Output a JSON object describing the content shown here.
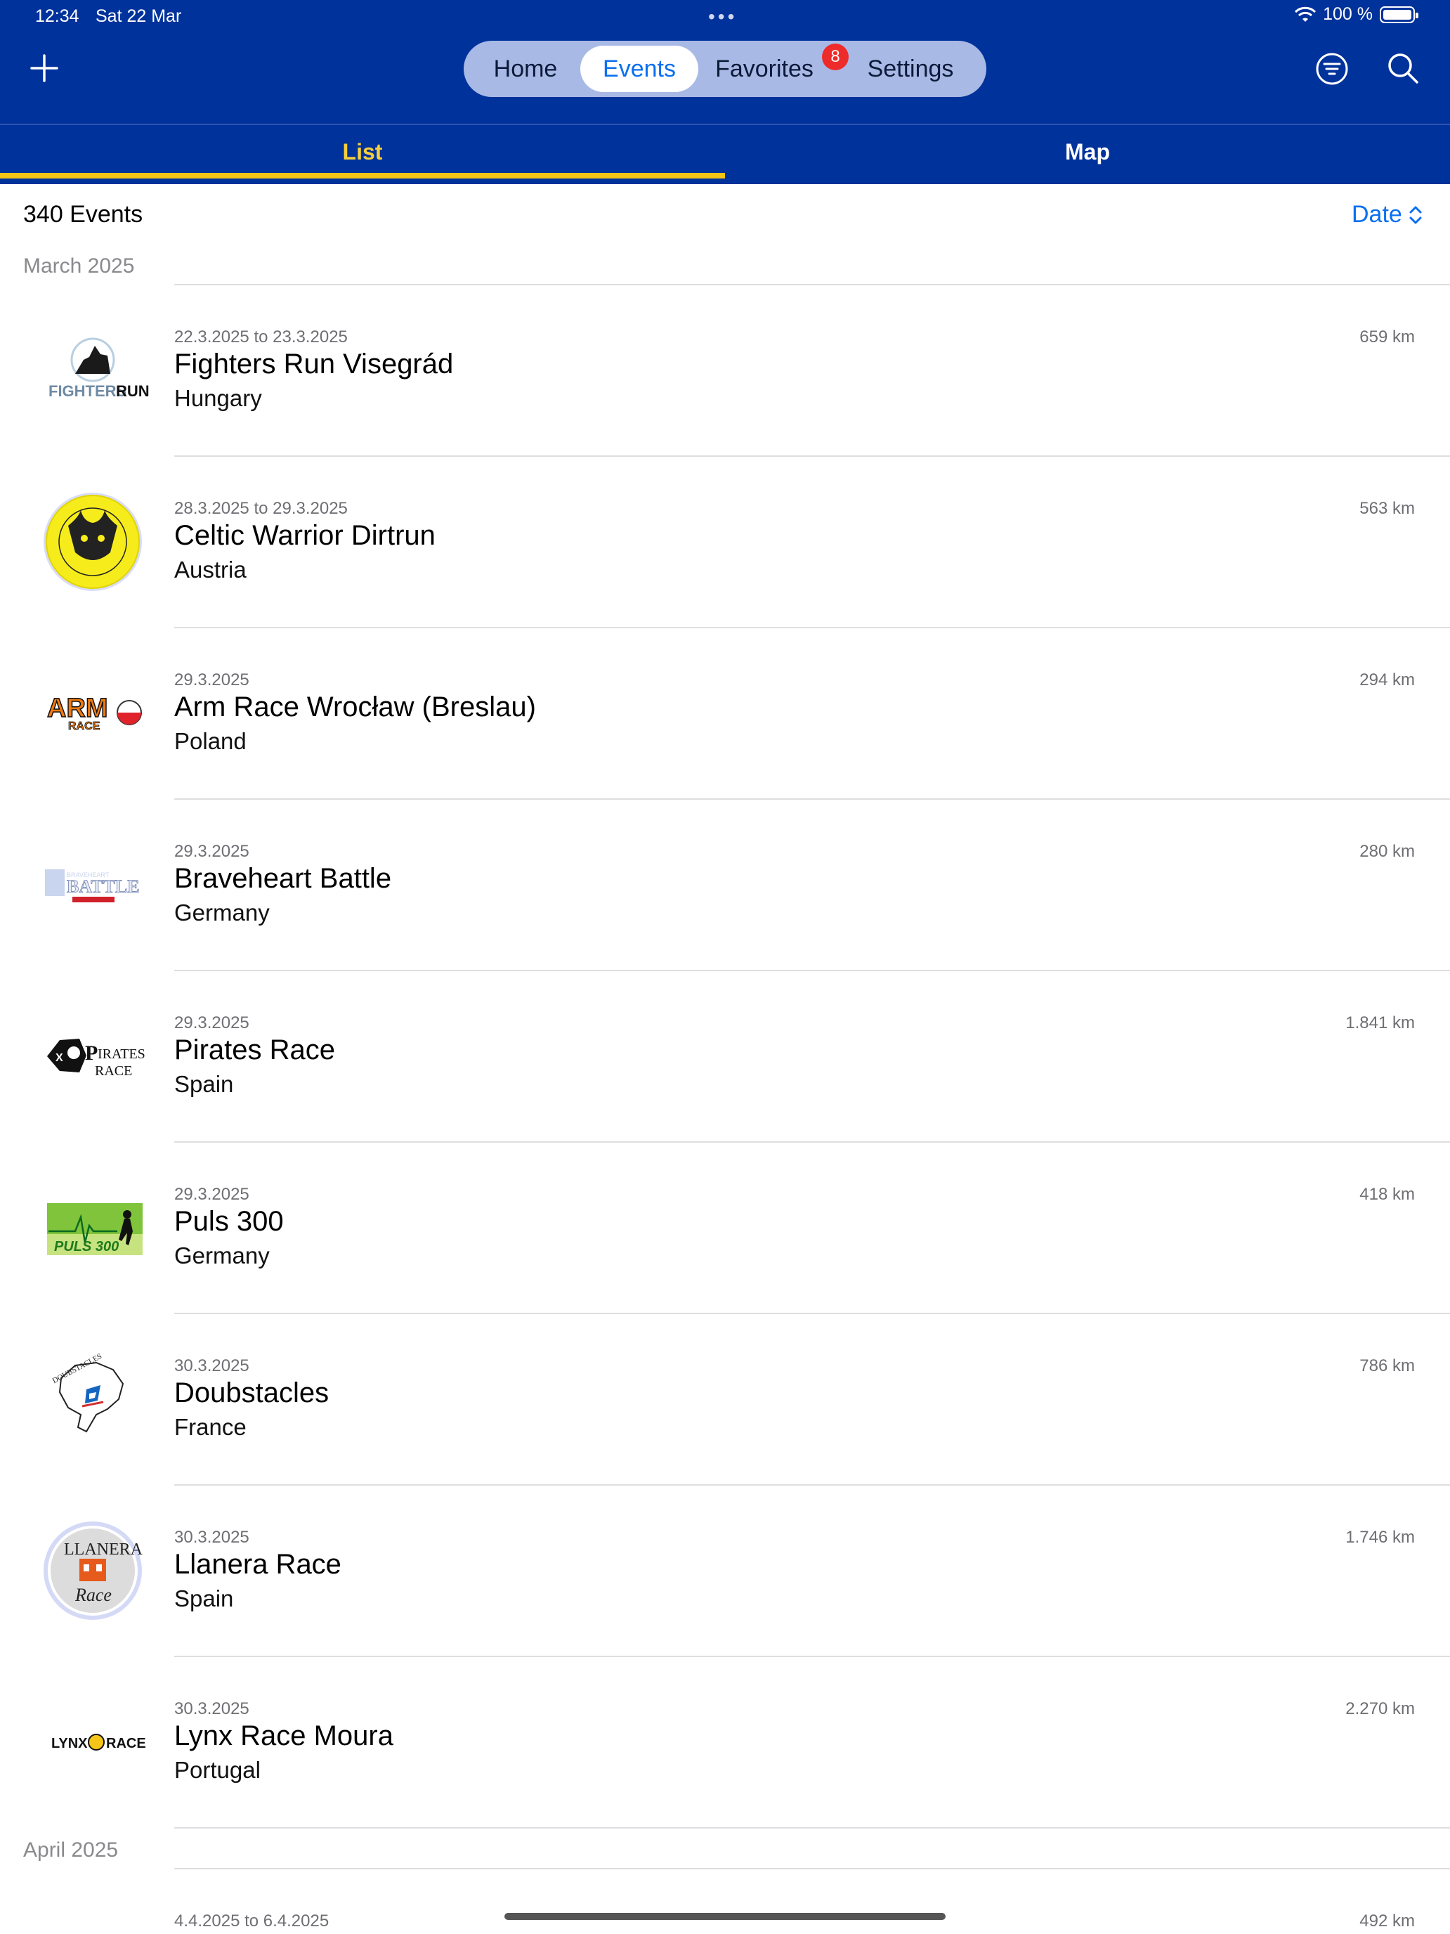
{
  "status": {
    "time": "12:34",
    "date": "Sat 22 Mar",
    "battery": "100 %"
  },
  "nav": {
    "tabs": [
      "Home",
      "Events",
      "Favorites",
      "Settings"
    ],
    "active": "Events",
    "favorites_badge": "8"
  },
  "subtabs": {
    "list": "List",
    "map": "Map",
    "active": "List"
  },
  "list_header": {
    "count": "340 Events",
    "sort": "Date"
  },
  "sections": [
    {
      "title": "March 2025"
    },
    {
      "title": "April 2025"
    }
  ],
  "events": [
    {
      "date": "22.3.2025 to 23.3.2025",
      "name": "Fighters Run Visegrád",
      "country": "Hungary",
      "distance": "659 km",
      "logo": "fighters-run-logo"
    },
    {
      "date": "28.3.2025 to 29.3.2025",
      "name": "Celtic Warrior Dirtrun",
      "country": "Austria",
      "distance": "563 km",
      "logo": "celtic-warrior-logo"
    },
    {
      "date": "29.3.2025",
      "name": "Arm Race Wrocław (Breslau)",
      "country": "Poland",
      "distance": "294 km",
      "logo": "arm-race-logo"
    },
    {
      "date": "29.3.2025",
      "name": "Braveheart Battle",
      "country": "Germany",
      "distance": "280 km",
      "logo": "braveheart-battle-logo"
    },
    {
      "date": "29.3.2025",
      "name": "Pirates Race",
      "country": "Spain",
      "distance": "1.841 km",
      "logo": "pirates-race-logo"
    },
    {
      "date": "29.3.2025",
      "name": "Puls 300",
      "country": "Germany",
      "distance": "418 km",
      "logo": "puls-300-logo"
    },
    {
      "date": "30.3.2025",
      "name": "Doubstacles",
      "country": "France",
      "distance": "786 km",
      "logo": "doubstacles-logo"
    },
    {
      "date": "30.3.2025",
      "name": "Llanera Race",
      "country": "Spain",
      "distance": "1.746 km",
      "logo": "llanera-race-logo"
    },
    {
      "date": "30.3.2025",
      "name": "Lynx Race Moura",
      "country": "Portugal",
      "distance": "2.270 km",
      "logo": "lynx-race-logo"
    },
    {
      "date": "4.4.2025 to 6.4.2025",
      "name": "",
      "country": "",
      "distance": "492 km",
      "logo": ""
    }
  ],
  "colors": {
    "nav_bg": "#00329b",
    "accent": "#0a6ff0",
    "active_tab": "#f7cf3c",
    "badge": "#ee2b2b"
  }
}
